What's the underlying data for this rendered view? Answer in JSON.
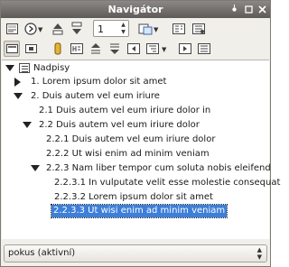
{
  "window": {
    "title": "Navigátor"
  },
  "titlebar_buttons": [
    "pin-icon",
    "minimize-icon",
    "close-icon"
  ],
  "toolbar1": {
    "spin_value": "1"
  },
  "tree": {
    "root": "Nadpisy",
    "items": [
      {
        "label": "1. Lorem ipsum dolor sit amet",
        "level": 1,
        "expander": "collapsed"
      },
      {
        "label": "2. Duis autem vel eum iriure",
        "level": 1,
        "expander": "expanded"
      },
      {
        "label": "2.1 Duis autem vel eum iriure dolor in",
        "level": 2,
        "expander": "none"
      },
      {
        "label": "2.2 Duis autem vel eum iriure dolor",
        "level": 2,
        "expander": "expanded"
      },
      {
        "label": "2.2.1 Duis autem vel eum iriure dolor",
        "level": 3,
        "expander": "none"
      },
      {
        "label": "2.2.2 Ut wisi enim ad minim veniam",
        "level": 3,
        "expander": "none"
      },
      {
        "label": "2.2.3 Nam liber tempor cum soluta nobis eleifend",
        "level": 3,
        "expander": "expanded"
      },
      {
        "label": "2.2.3.1 In vulputate velit esse molestie consequat",
        "level": 4,
        "expander": "none"
      },
      {
        "label": "2.2.3.2 Lorem ipsum dolor sit amet",
        "level": 4,
        "expander": "none"
      },
      {
        "label": "2.2.3.3 Ut wisi enim ad minim veniam",
        "level": 4,
        "expander": "none",
        "selected": true
      }
    ]
  },
  "statusbar": {
    "document": "pokus (aktivní)"
  },
  "colors": {
    "selection": "#3d7fd9",
    "titlebar": "#6f6c69"
  }
}
